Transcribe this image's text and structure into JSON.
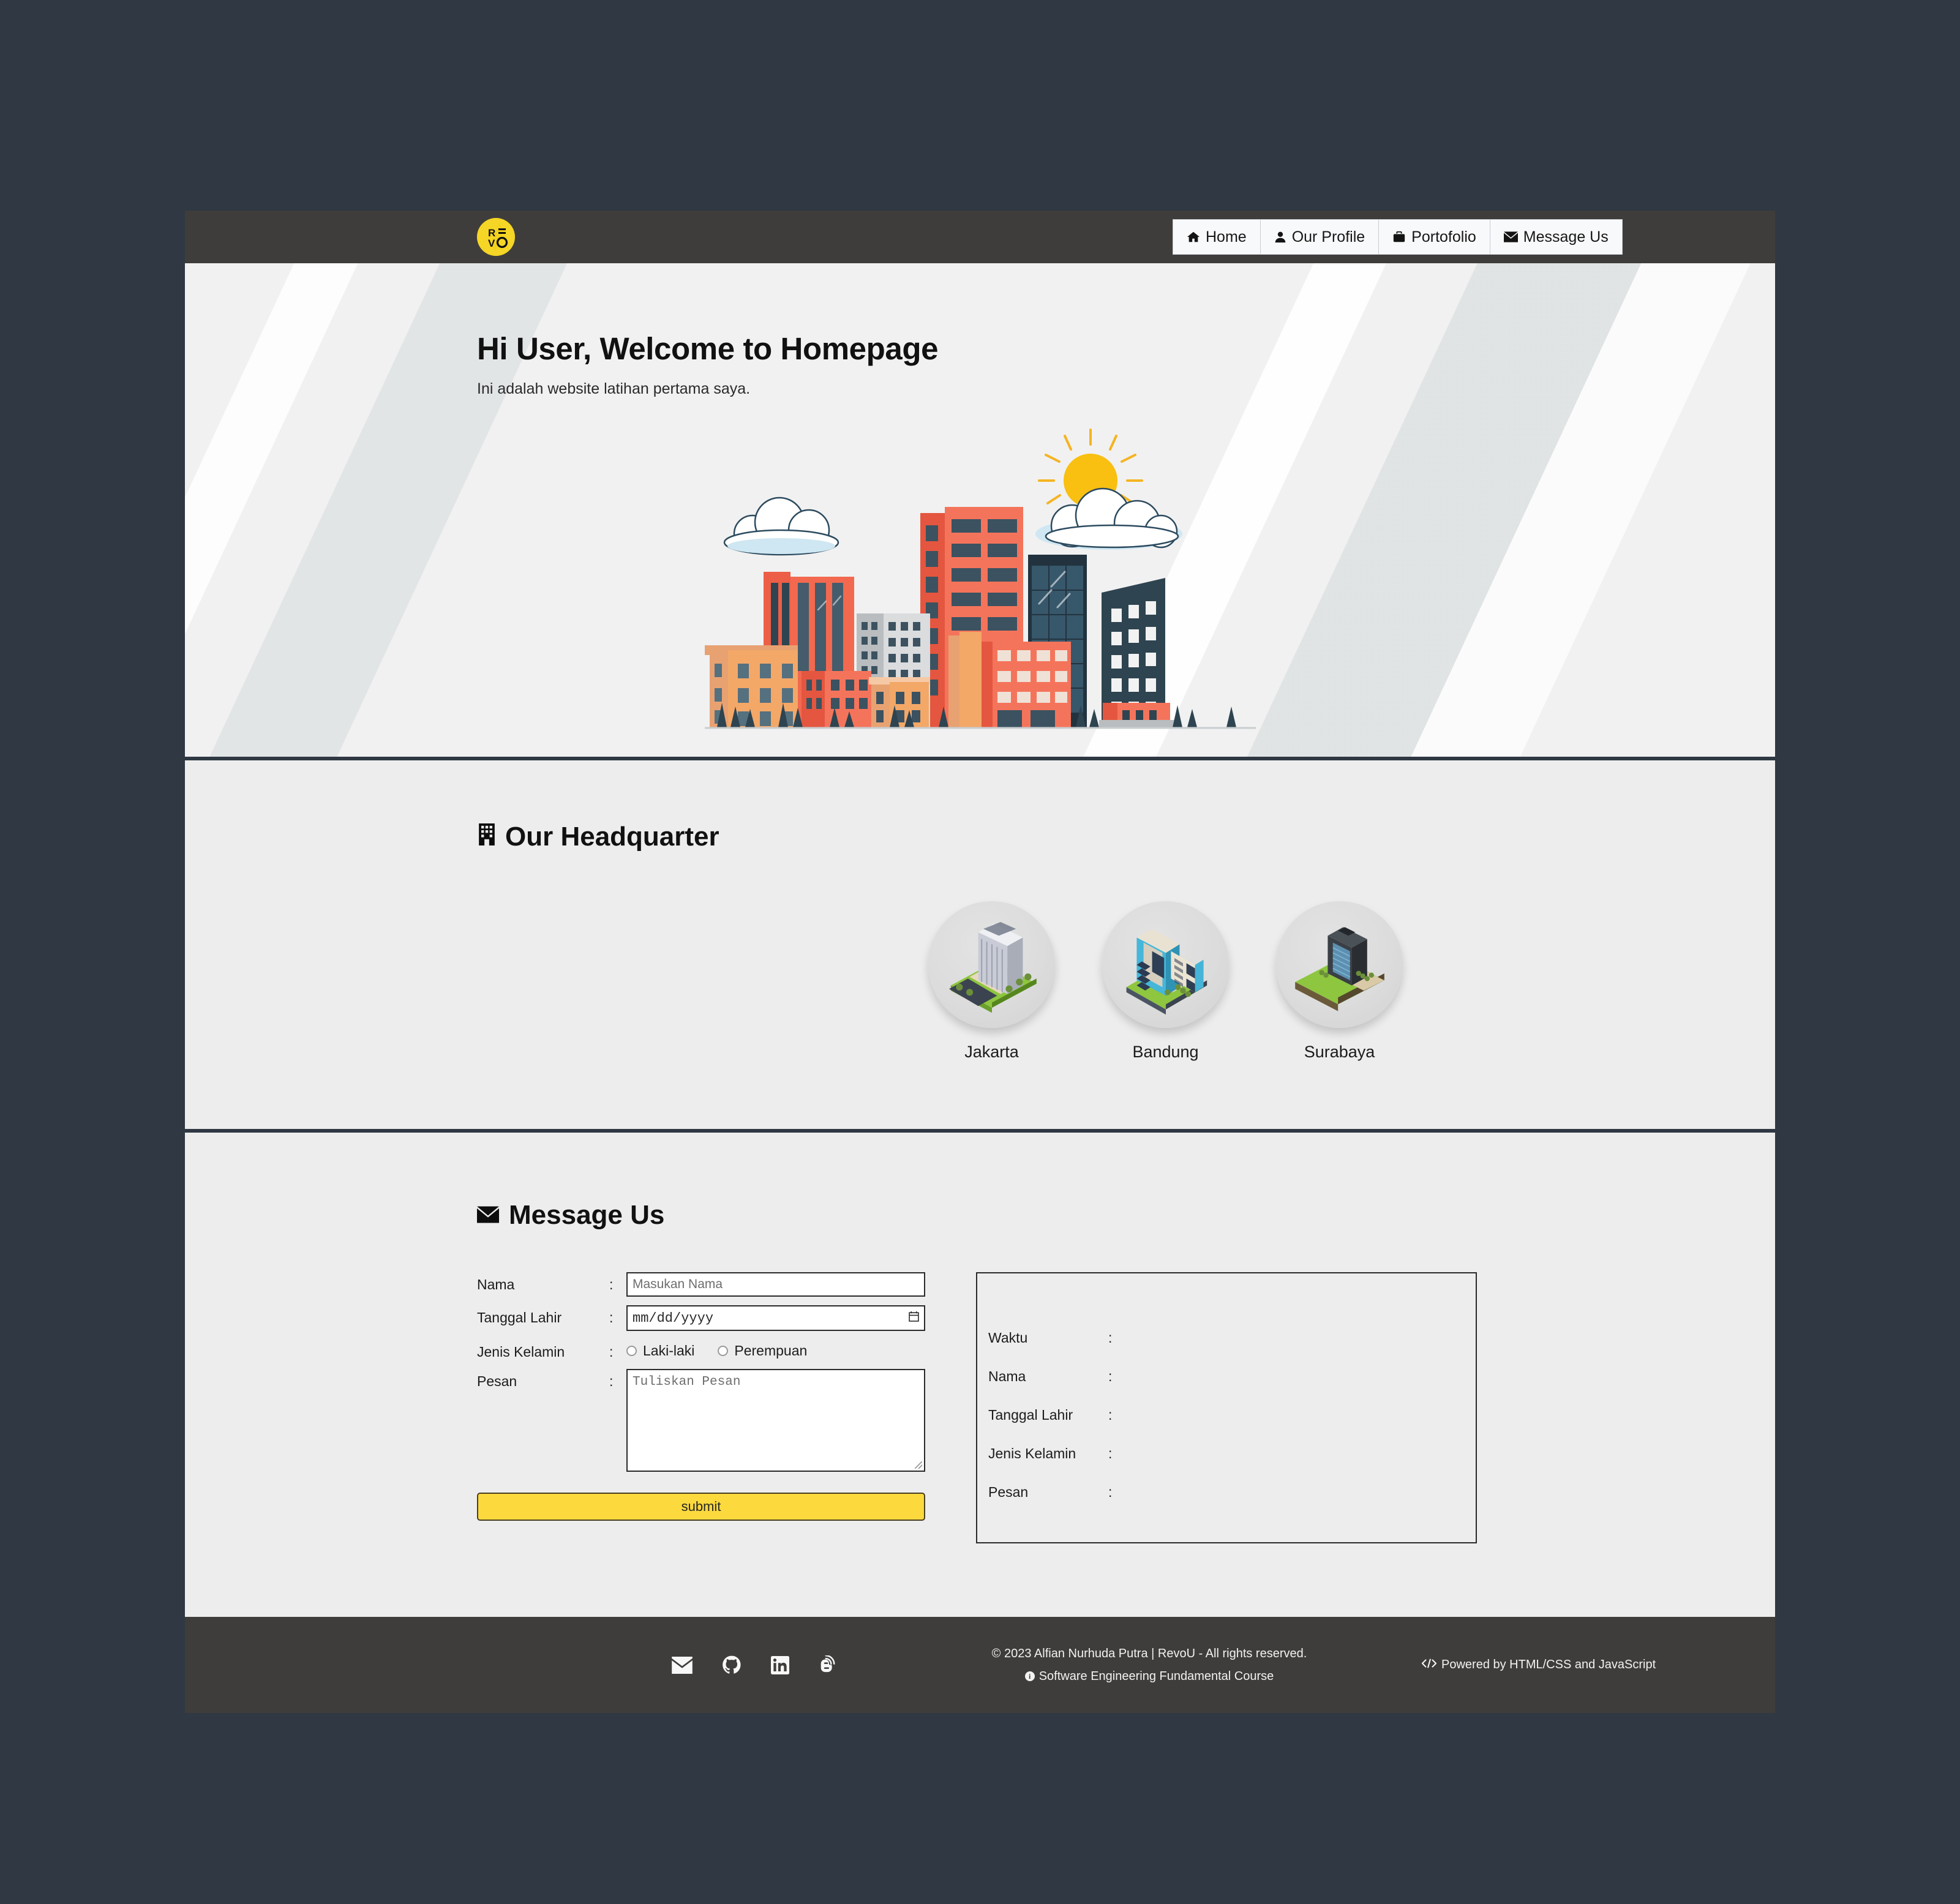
{
  "navbar": {
    "logo_text": "REVO",
    "items": [
      {
        "label": "Home",
        "icon": "home-icon"
      },
      {
        "label": "Our Profile",
        "icon": "user-icon"
      },
      {
        "label": "Portofolio",
        "icon": "briefcase-icon"
      },
      {
        "label": "Message Us",
        "icon": "envelope-icon"
      }
    ]
  },
  "hero": {
    "title": "Hi User, Welcome to Homepage",
    "subtitle": "Ini adalah website latihan pertama saya.",
    "illustration": "city-skyline-with-sun-and-clouds"
  },
  "headquarter": {
    "title": "Our Headquarter",
    "icon": "building-icon",
    "cards": [
      {
        "label": "Jakarta",
        "icon": "isometric-tower-building"
      },
      {
        "label": "Bandung",
        "icon": "isometric-office-building"
      },
      {
        "label": "Surabaya",
        "icon": "isometric-highrise-building"
      }
    ]
  },
  "message": {
    "title": "Message Us",
    "icon": "envelope-icon",
    "colon": ":",
    "fields": {
      "nama_label": "Nama",
      "nama_placeholder": "Masukan Nama",
      "tanggal_label": "Tanggal Lahir",
      "tanggal_placeholder": "mm/dd/yyyy",
      "jenis_label": "Jenis Kelamin",
      "gender_options": [
        "Laki-laki",
        "Perempuan"
      ],
      "pesan_label": "Pesan",
      "pesan_placeholder": "Tuliskan Pesan"
    },
    "submit_label": "submit",
    "result_rows": [
      {
        "label": "Waktu",
        "value": ""
      },
      {
        "label": "Nama",
        "value": ""
      },
      {
        "label": "Tanggal Lahir",
        "value": ""
      },
      {
        "label": "Jenis Kelamin",
        "value": ""
      },
      {
        "label": "Pesan",
        "value": ""
      }
    ]
  },
  "footer": {
    "social": [
      {
        "name": "envelope-icon"
      },
      {
        "name": "github-icon"
      },
      {
        "name": "linkedin-icon"
      },
      {
        "name": "blogger-icon"
      }
    ],
    "copyright": "© 2023 Alfian Nurhuda Putra | RevoU - All rights reserved.",
    "course": "Software Engineering Fundamental Course",
    "powered": "Powered by HTML/CSS and JavaScript"
  },
  "colors": {
    "page_bg": "#2f3843",
    "navbar_bg": "#3f3d3b",
    "content_bg": "#ededed",
    "accent_yellow": "#fcd93d",
    "logo_yellow": "#f5d525"
  }
}
